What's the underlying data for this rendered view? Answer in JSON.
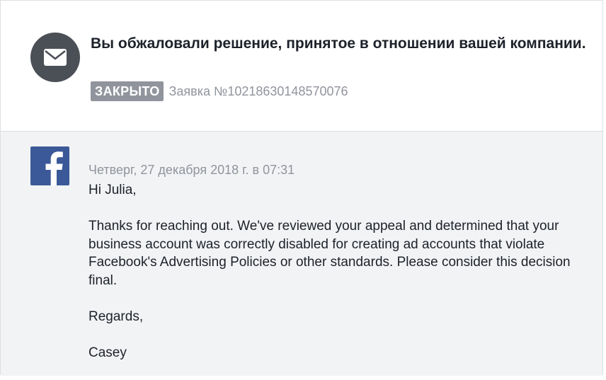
{
  "header": {
    "icon": "envelope-icon",
    "title": "Вы обжаловали решение, принятое в отношении вашей компании.",
    "status_badge": "ЗАКРЫТО",
    "ticket_label": "Заявка №10218630148570076"
  },
  "message": {
    "sender_icon": "facebook-logo-icon",
    "timestamp": "Четверг, 27 декабря 2018 г. в 07:31",
    "greeting": "Hi Julia,",
    "body": "Thanks for reaching out. We've reviewed your appeal and determined that your business account was correctly disabled for creating ad accounts that violate Facebook's Advertising Policies or other standards. Please consider this decision final.",
    "closing": "Regards,",
    "signature": "Casey"
  },
  "colors": {
    "avatar_bg": "#4b4f56",
    "badge_bg": "#90949c",
    "facebook_blue": "#3b5998",
    "body_bg": "#f2f3f5",
    "text": "#1d2129",
    "muted_text": "#90949c"
  }
}
